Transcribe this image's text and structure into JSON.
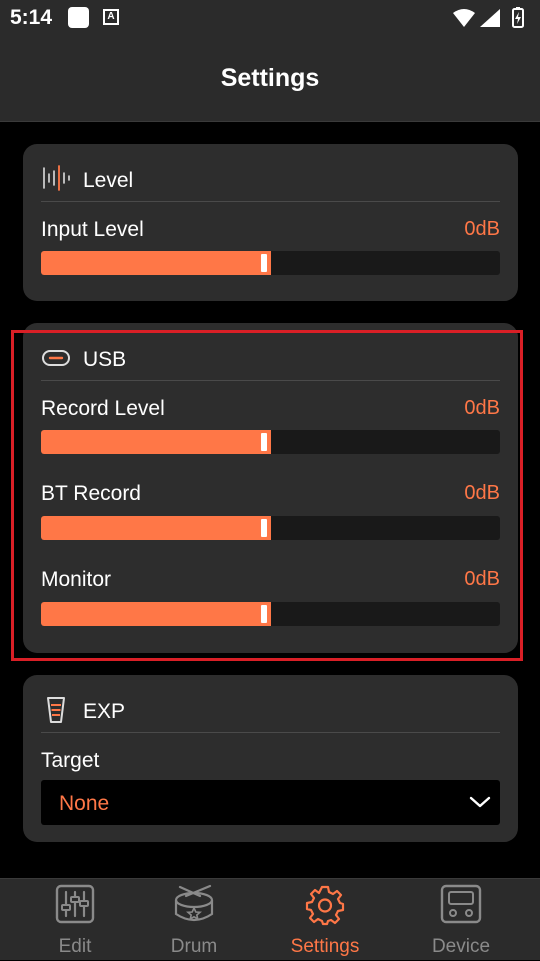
{
  "status": {
    "time": "5:14",
    "a_label": "A",
    "icons": [
      "notification-square-icon",
      "accessibility-a-icon",
      "wifi-icon",
      "cell-signal-icon",
      "battery-icon"
    ]
  },
  "header": {
    "title": "Settings"
  },
  "level_card": {
    "title": "Level",
    "icon": "waveform-icon",
    "input_level": {
      "label": "Input Level",
      "value": "0dB",
      "fill_fraction": 0.5
    }
  },
  "usb_card": {
    "title": "USB",
    "icon": "usb-icon",
    "record_level": {
      "label": "Record Level",
      "value": "0dB",
      "fill_fraction": 0.5
    },
    "bt_record": {
      "label": "BT Record",
      "value": "0dB",
      "fill_fraction": 0.5
    },
    "monitor": {
      "label": "Monitor",
      "value": "0dB",
      "fill_fraction": 0.5
    }
  },
  "exp_card": {
    "title": "EXP",
    "icon": "expression-pedal-icon",
    "target": {
      "label": "Target",
      "selected": "None"
    }
  },
  "nav": {
    "items": [
      {
        "label": "Edit",
        "icon": "sliders-icon",
        "active": false
      },
      {
        "label": "Drum",
        "icon": "drum-icon",
        "active": false
      },
      {
        "label": "Settings",
        "icon": "gear-icon",
        "active": true
      },
      {
        "label": "Device",
        "icon": "device-icon",
        "active": false
      }
    ]
  },
  "colors": {
    "accent": "#ff7747",
    "card": "#2d2d2d",
    "background": "#000000",
    "highlight": "#d91f26"
  }
}
